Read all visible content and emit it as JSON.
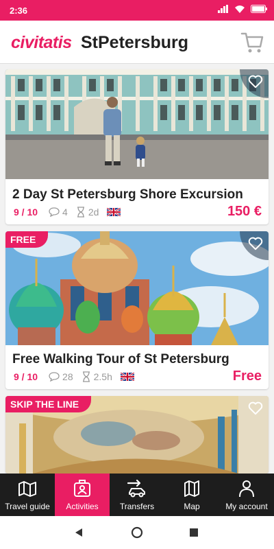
{
  "status": {
    "time": "2:36"
  },
  "header": {
    "logo": "civitatis",
    "city": "StPetersburg"
  },
  "cards": [
    {
      "title": "2 Day St Petersburg Shore Excursion",
      "rating": "9 / 10",
      "comments": "4",
      "duration": "2d",
      "price": "150 €",
      "tag": ""
    },
    {
      "title": "Free Walking Tour of St Petersburg",
      "rating": "9 / 10",
      "comments": "28",
      "duration": "2.5h",
      "price": "Free",
      "tag": "FREE"
    },
    {
      "title": "",
      "tag": "SKIP THE LINE"
    }
  ],
  "tabs": [
    {
      "label": "Travel guide",
      "icon": "map-book-icon"
    },
    {
      "label": "Activities",
      "icon": "ticket-person-icon",
      "active": true
    },
    {
      "label": "Transfers",
      "icon": "car-arrow-icon"
    },
    {
      "label": "Map",
      "icon": "map-icon"
    },
    {
      "label": "My account",
      "icon": "person-icon"
    }
  ],
  "colors": {
    "brand": "#e91e63",
    "tabbar": "#1d1d1d"
  }
}
